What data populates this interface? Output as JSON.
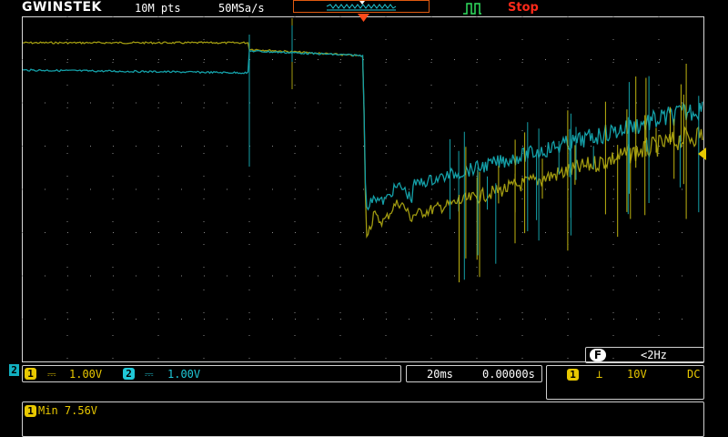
{
  "header": {
    "brand": "GWINSTEK",
    "memory_depth": "10M pts",
    "sample_rate": "50MSa/s",
    "run_status": "Stop",
    "run_status_color": "#ff2a1a"
  },
  "channels": {
    "ch1": {
      "number": "1",
      "coupling_symbol": "⎓",
      "scale": "1.00V",
      "color": "#e8c800"
    },
    "ch2": {
      "number": "2",
      "coupling_symbol": "⎓",
      "scale": "1.00V",
      "color": "#20c8d8"
    }
  },
  "active_channel_marker": "2",
  "timebase": {
    "scale": "20ms",
    "position": "0.00000s"
  },
  "filter": {
    "badge": "F",
    "value": "<2Hz"
  },
  "trigger": {
    "source": "1",
    "slope_symbol": "⊥",
    "level": "10V",
    "coupling": "DC"
  },
  "measurement": {
    "channel": "1",
    "text": "Min 7.56V"
  },
  "icons": [
    "trigger-marker-icon",
    "acquire-mode-icon",
    "trigger-level-arrow-icon",
    "trigger-slope-icon"
  ]
}
